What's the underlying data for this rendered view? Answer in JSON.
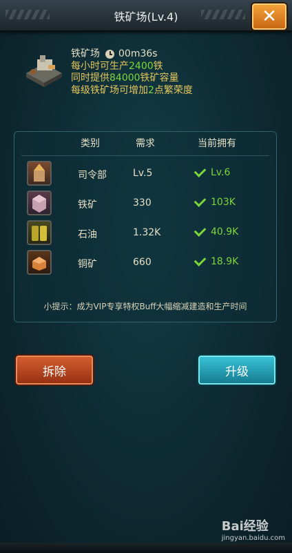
{
  "header": {
    "title": "铁矿场(Lv.4)",
    "close_label": "✕"
  },
  "building": {
    "name": "铁矿场",
    "timer": "00m36s",
    "line1_prefix": "每小时可生产",
    "line1_value": "2400",
    "line1_suffix": "铁",
    "line2_prefix": "同时提供",
    "line2_value": "84000",
    "line2_suffix": "铁矿容量",
    "line3_prefix": "每级铁矿场可增加",
    "line3_value": "2",
    "line3_suffix": "点繁荣度"
  },
  "requirements": {
    "headers": {
      "category": "类别",
      "need": "需求",
      "current": "当前拥有"
    },
    "rows": [
      {
        "name": "司令部",
        "need": "Lv.5",
        "have": "Lv.6",
        "icon": "command-hq-icon"
      },
      {
        "name": "铁矿",
        "need": "330",
        "have": "103K",
        "icon": "iron-ore-icon"
      },
      {
        "name": "石油",
        "need": "1.32K",
        "have": "40.9K",
        "icon": "oil-barrel-icon"
      },
      {
        "name": "铜矿",
        "need": "660",
        "have": "18.9K",
        "icon": "copper-ore-icon"
      }
    ],
    "tip": "小提示：成为VIP专享特权Buff大幅缩减建造和生产时间"
  },
  "buttons": {
    "demolish": "拆除",
    "upgrade": "升级"
  },
  "watermark": {
    "brand": "Bai经验",
    "url": "jingyan.baidu.com"
  },
  "colors": {
    "accent_green": "#7dd63a",
    "gold_text": "#e4c75c",
    "close_orange": "#f29a34",
    "upgrade_blue": "#24a6be",
    "demolish_red": "#c04a20"
  }
}
